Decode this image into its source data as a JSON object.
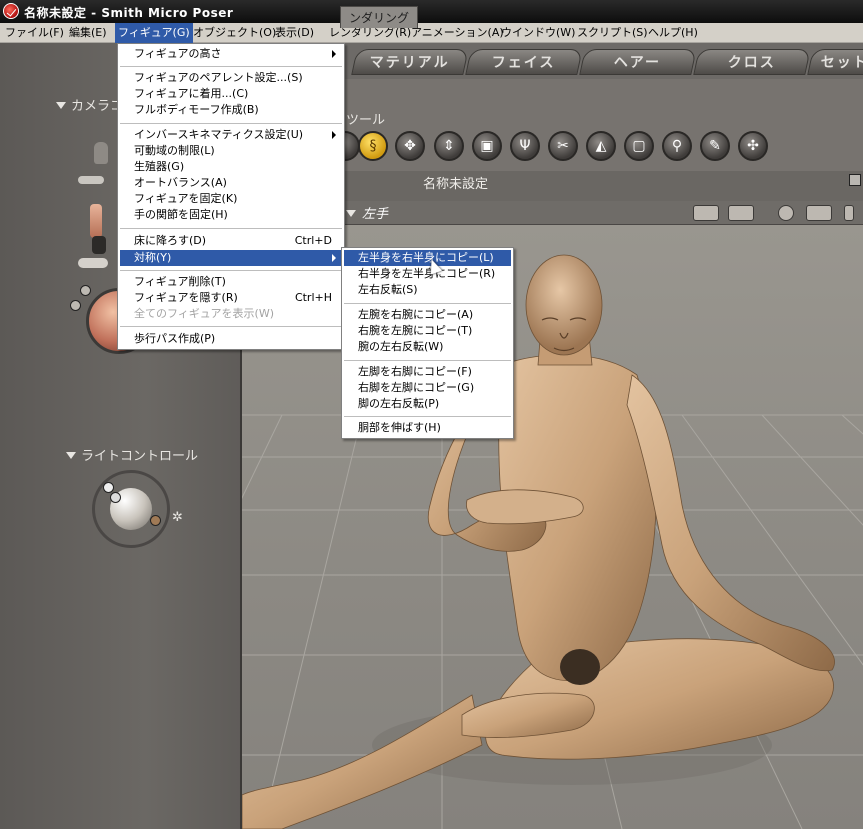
{
  "window": {
    "title": "名称未設定 - Smith Micro Poser"
  },
  "menubar": [
    {
      "label": "ファイル(F)"
    },
    {
      "label": "編集(E)"
    },
    {
      "label": "フィギュア(G)",
      "active": true
    },
    {
      "label": "オブジェクト(O)"
    },
    {
      "label": "表示(D)"
    },
    {
      "label": "レンダリング(R)"
    },
    {
      "label": "アニメーション(A)"
    },
    {
      "label": "ウインドウ(W)"
    },
    {
      "label": "スクリプト(S)"
    },
    {
      "label": "ヘルプ(H)"
    }
  ],
  "figure_menu": {
    "items": [
      {
        "label": "フィギュアの高さ",
        "submenu": true
      },
      {
        "label": "フィギュアのペアレント設定...(S)"
      },
      {
        "label": "フィギュアに着用...(C)"
      },
      {
        "label": "フルボディモーフ作成(B)"
      },
      {
        "label": "インバースキネマティクス設定(U)",
        "submenu": true
      },
      {
        "label": "可動域の制限(L)"
      },
      {
        "label": "生殖器(G)"
      },
      {
        "label": "オートバランス(A)"
      },
      {
        "label": "フィギュアを固定(K)"
      },
      {
        "label": "手の関節を固定(H)"
      },
      {
        "label": "床に降ろす(D)",
        "shortcut": "Ctrl+D"
      },
      {
        "label": "対称(Y)",
        "submenu": true,
        "highlight": true
      },
      {
        "label": "フィギュア削除(T)"
      },
      {
        "label": "フィギュアを隠す(R)",
        "shortcut": "Ctrl+H"
      },
      {
        "label": "全てのフィギュアを表示(W)",
        "disabled": true
      },
      {
        "label": "歩行パス作成(P)"
      }
    ]
  },
  "symmetry_menu": {
    "items": [
      {
        "label": "左半身を右半身にコピー(L)",
        "highlight": true
      },
      {
        "label": "右半身を左半身にコピー(R)"
      },
      {
        "label": "左右反転(S)"
      },
      {
        "label": "左腕を右腕にコピー(A)"
      },
      {
        "label": "右腕を左腕にコピー(T)"
      },
      {
        "label": "腕の左右反転(W)"
      },
      {
        "label": "左脚を右脚にコピー(F)"
      },
      {
        "label": "右脚を左脚にコピー(G)"
      },
      {
        "label": "脚の左右反転(P)"
      },
      {
        "label": "胴部を伸ばす(H)"
      }
    ]
  },
  "left_panel": {
    "camera_label": "カメラコ",
    "light_label": "ライトコントロール"
  },
  "top_tabs": [
    "マテリアル",
    "フェイス",
    "ヘアー",
    "クロス",
    "セット"
  ],
  "tools": {
    "label": "ツール",
    "icons": [
      "rotate-icon",
      "twist-icon",
      "translate-icon",
      "translate-in-out-icon",
      "scale-icon",
      "taper-icon",
      "chain-break-icon",
      "color-icon",
      "grouping-icon",
      "view-magnifier-icon",
      "morph-brush-icon",
      "direct-manipulation-icon"
    ]
  },
  "document": {
    "render_tab": "ンダリング",
    "title": "名称未設定"
  },
  "pose_bar": {
    "current_actor": "左手"
  },
  "colors": {
    "menu_highlight": "#2f5aa8",
    "menubar_bg": "#d4d0c8",
    "viewport_bg": "#8c8983",
    "figure_skin": "#c9a27a"
  }
}
